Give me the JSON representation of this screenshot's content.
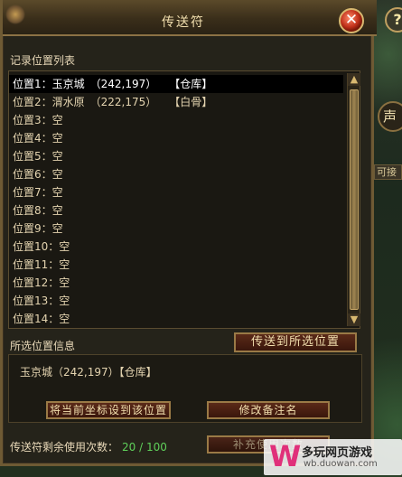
{
  "window": {
    "title": "传送符"
  },
  "list": {
    "label": "记录位置列表",
    "items": [
      {
        "slot": "位置1：",
        "name": "玉京城",
        "coord": "（242,197）",
        "note": "【仓库】"
      },
      {
        "slot": "位置2：",
        "name": "渭水原",
        "coord": "（222,175）",
        "note": "【白骨】"
      },
      {
        "slot": "位置3：",
        "name": "空"
      },
      {
        "slot": "位置4：",
        "name": "空"
      },
      {
        "slot": "位置5：",
        "name": "空"
      },
      {
        "slot": "位置6：",
        "name": "空"
      },
      {
        "slot": "位置7：",
        "name": "空"
      },
      {
        "slot": "位置8：",
        "name": "空"
      },
      {
        "slot": "位置9：",
        "name": "空"
      },
      {
        "slot": "位置10：",
        "name": "空"
      },
      {
        "slot": "位置11：",
        "name": "空"
      },
      {
        "slot": "位置12：",
        "name": "空"
      },
      {
        "slot": "位置13：",
        "name": "空"
      },
      {
        "slot": "位置14：",
        "name": "空"
      }
    ]
  },
  "selected_info": {
    "label": "所选位置信息",
    "text": "玉京城（242,197）【仓库】"
  },
  "buttons": {
    "teleport": "传送到所选位置",
    "set_current": "将当前坐标设到该位置",
    "edit_note": "修改备注名",
    "recharge": "补充使用次数"
  },
  "usage": {
    "label": "传送符剩余使用次数：",
    "value": "20 / 100"
  },
  "side": {
    "help": "?",
    "round": "声",
    "tab": "可接"
  },
  "watermark": {
    "title": "多玩网页游戏",
    "url": "wb.duowan.com",
    "logo": "W"
  },
  "colors": {
    "selected_row": "#000000",
    "count": "#5fd05a",
    "frame": "#6e5a34"
  }
}
